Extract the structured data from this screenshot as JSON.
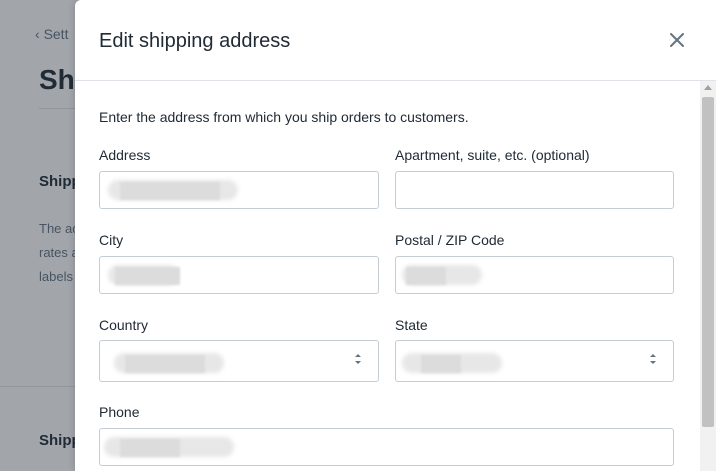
{
  "background": {
    "back_link": "Sett",
    "page_title": "Shi",
    "section_title": "Shipp",
    "description_lines": [
      "The ac",
      "rates a",
      "labels"
    ],
    "section_title_2": "Shipp"
  },
  "modal": {
    "title": "Edit shipping address",
    "close_icon": "close-icon",
    "intro": "Enter the address from which you ship orders to customers.",
    "fields": {
      "address": {
        "label": "Address",
        "value": ""
      },
      "apartment": {
        "label": "Apartment, suite, etc. (optional)",
        "value": ""
      },
      "city": {
        "label": "City",
        "value": ""
      },
      "zip": {
        "label": "Postal / ZIP Code",
        "value": ""
      },
      "country": {
        "label": "Country",
        "value": ""
      },
      "state": {
        "label": "State",
        "value": ""
      },
      "phone": {
        "label": "Phone",
        "value": ""
      }
    }
  },
  "colors": {
    "overlay": "#212b36",
    "border": "#c4cdd5",
    "text": "#212b36"
  }
}
